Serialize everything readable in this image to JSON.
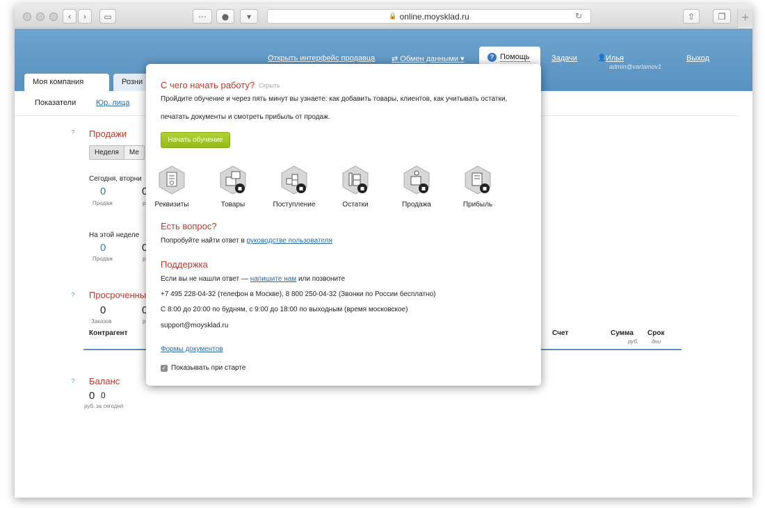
{
  "browser": {
    "url": "online.moysklad.ru",
    "reload": "↻"
  },
  "topnav": {
    "seller_link": "Открыть интерфейс продавца",
    "exchange": "⇄ Обмен данными ▾",
    "help": "Помощь",
    "tasks": "Задачи",
    "user_name": "Илья",
    "user_email": "admin@varlamov1",
    "logout": "Выход"
  },
  "tabs": {
    "company": "Моя компания",
    "second_partial": "Розни"
  },
  "subnav": {
    "indicators": "Показатели",
    "legal": "Юр. лица"
  },
  "sales": {
    "title": "Продажи",
    "seg_week": "Неделя",
    "seg_month_partial": "Ме",
    "today": "Сегодня, вторни",
    "today_value": "0",
    "today_unit": "Продаж",
    "week": "На этой неделе",
    "week_value": "0",
    "week_unit": "Продаж",
    "cut_value": "0",
    "cut_unit": "р"
  },
  "overdue": {
    "title": "Просроченны",
    "value": "0",
    "unit": "Заказов",
    "cut_value": "0",
    "cut_unit": "р",
    "col_contractor": "Контрагент",
    "col_invoice": "Счет",
    "col_sum": "Сумма",
    "col_sum_unit": "руб.",
    "col_term": "Срок",
    "col_term_unit": "дни"
  },
  "balance": {
    "title": "Баланс",
    "value": "0",
    "unit": "руб.",
    "today_value": "0",
    "today_unit": "за сегодня"
  },
  "popup": {
    "title": "С чего начать работу?",
    "hide": "Скрыть",
    "intro_1": "Пройдите обучение и через пять минут вы узнаете: как добавить товары, клиентов, как учитывать остатки,",
    "intro_2": "печатать документы и смотреть прибыль от продаж.",
    "start_button": "Начать обучение",
    "steps": [
      "Реквизиты",
      "Товары",
      "Поступление",
      "Остатки",
      "Продажа",
      "Прибыль"
    ],
    "question_title": "Есть вопрос?",
    "question_text": "Попробуйте найти ответ в",
    "question_link": "руководстве пользователя",
    "support_title": "Поддержка",
    "support_text_1": "Если вы не нашли ответ —",
    "support_link": "напишите нам",
    "support_text_2": "или позвоните",
    "phones": "+7 495 228-04-32 (телефон в Москве), 8 800 250-04-32 (Звонки по России бесплатно)",
    "hours": "С 8:00 до 20:00 по будням, с 9:00 до 18:00 по выходным (время московское)",
    "email": "support@moysklad.ru",
    "forms_link": "Формы документов",
    "show_on_start": "Показывать при старте"
  },
  "colors": {
    "header": "#5f98c6",
    "accent_red": "#c0392b",
    "link": "#2a6aa8",
    "button_green": "#a3c82a"
  }
}
